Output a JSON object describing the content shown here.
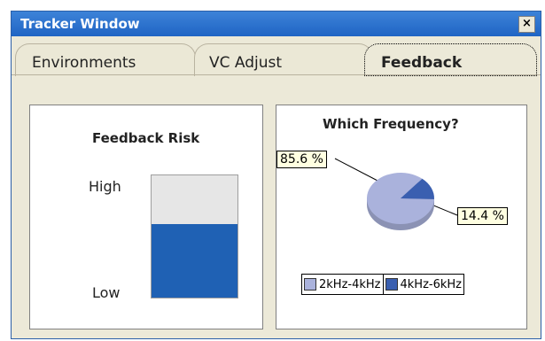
{
  "window": {
    "title": "Tracker Window",
    "close_symbol": "×"
  },
  "tabs": [
    {
      "label": "Environments",
      "active": false
    },
    {
      "label": "VC Adjust",
      "active": false
    },
    {
      "label": "Feedback",
      "active": true
    }
  ],
  "feedback_risk": {
    "title": "Feedback Risk",
    "high_label": "High",
    "low_label": "Low",
    "level": 0.6,
    "fill_color": "#1f61b4"
  },
  "frequency": {
    "title": "Which Frequency?",
    "slice_labels": [
      "85.6 %",
      "14.4 %"
    ],
    "legend": [
      {
        "label": "2kHz-4kHz",
        "color": "#aab2dc"
      },
      {
        "label": "4kHz-6kHz",
        "color": "#3a5fb0"
      }
    ]
  },
  "chart_data": {
    "type": "pie",
    "title": "Which Frequency?",
    "categories": [
      "2kHz-4kHz",
      "4kHz-6kHz"
    ],
    "values": [
      85.6,
      14.4
    ],
    "colors": [
      "#aab2dc",
      "#3a5fb0"
    ],
    "legend": "bottom"
  }
}
